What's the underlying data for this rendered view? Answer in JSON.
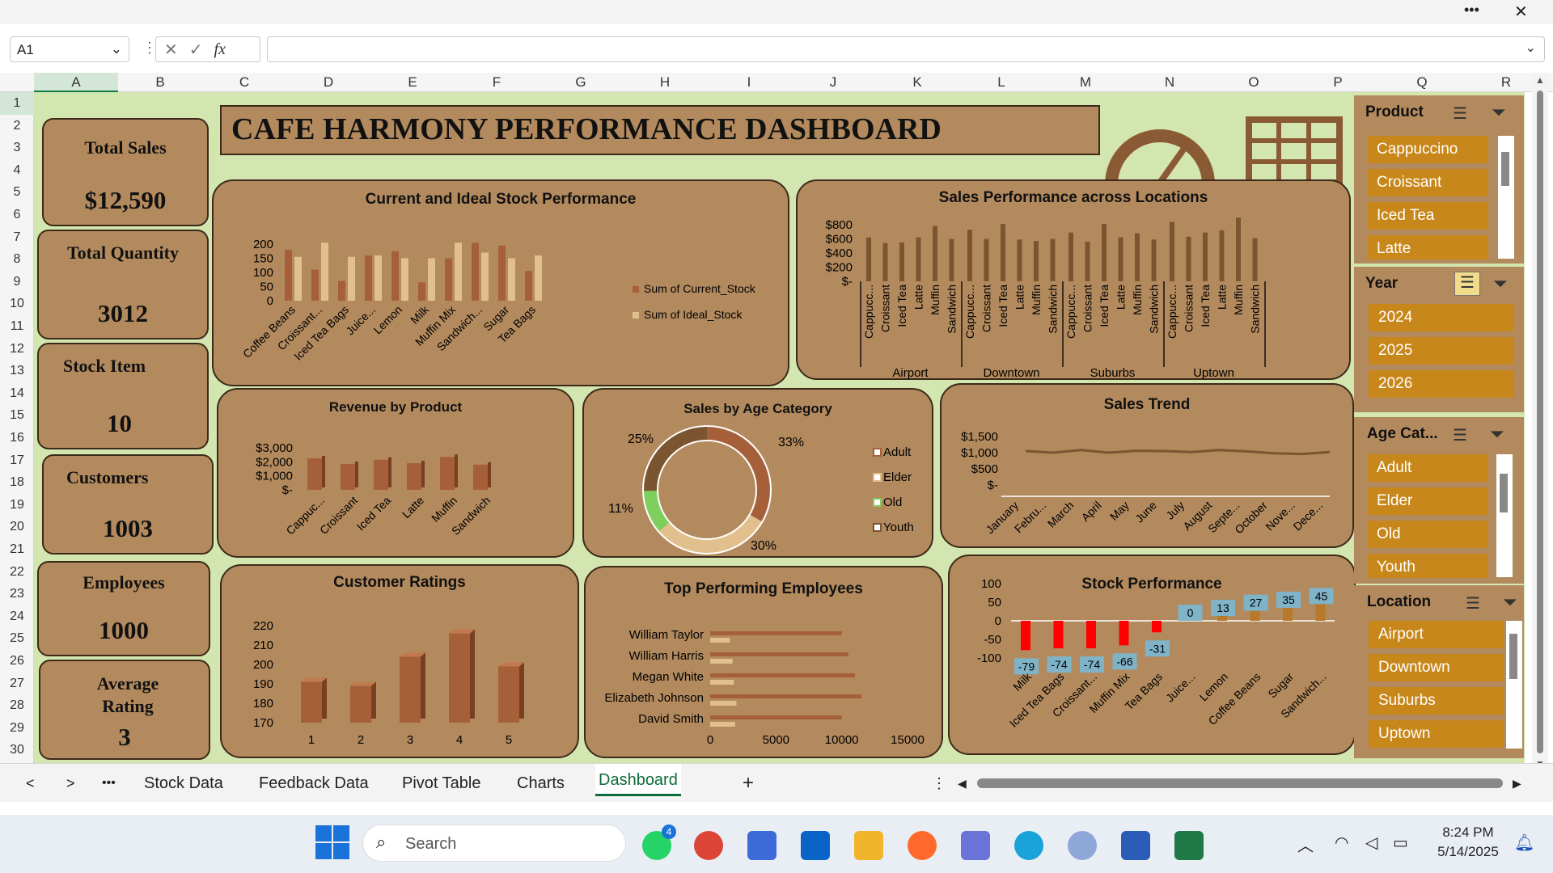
{
  "window": {
    "more_label": "•••",
    "close_label": "✕"
  },
  "formula": {
    "cell_ref": "A1",
    "fx_label": "fx",
    "value": ""
  },
  "columns": [
    "A",
    "B",
    "C",
    "D",
    "E",
    "F",
    "G",
    "H",
    "I",
    "J",
    "K",
    "L",
    "M",
    "N",
    "O",
    "P",
    "Q",
    "R"
  ],
  "rows": [
    "1",
    "2",
    "3",
    "4",
    "5",
    "6",
    "7",
    "8",
    "9",
    "10",
    "11",
    "12",
    "13",
    "14",
    "15",
    "16",
    "17",
    "18",
    "19",
    "20",
    "21",
    "22",
    "23",
    "24",
    "25",
    "26",
    "27",
    "28",
    "29",
    "30"
  ],
  "dashboard": {
    "title": "CAFE HARMONY PERFORMANCE DASHBOARD",
    "kpis": [
      {
        "label": "Total Sales",
        "value": "$12,590"
      },
      {
        "label": "Total Quantity",
        "value": "3012"
      },
      {
        "label": "Stock Item",
        "value": "10"
      },
      {
        "label": "Customers",
        "value": "1003"
      },
      {
        "label": "Employees",
        "value": "1000"
      },
      {
        "label": "Average Rating",
        "value": "3"
      }
    ]
  },
  "charts": {
    "stock": {
      "title": "Current and Ideal Stock Performance",
      "legend_current": "Sum of Current_Stock",
      "legend_ideal": "Sum of Ideal_Stock"
    },
    "locations": {
      "title": "Sales Performance across Locations"
    },
    "revenue": {
      "title": "Revenue by Product"
    },
    "age": {
      "title": "Sales by Age Category"
    },
    "trend": {
      "title": "Sales Trend"
    },
    "ratings": {
      "title": "Customer Ratings"
    },
    "employees": {
      "title": "Top Performing Employees"
    },
    "stockperf": {
      "title": "Stock Performance"
    }
  },
  "chart_data": [
    {
      "type": "bar",
      "title": "Current and Ideal Stock Performance",
      "categories": [
        "Coffee Beans",
        "Croissant...",
        "Iced Tea Bags",
        "Juice...",
        "Lemon",
        "Milk",
        "Muffin Mix",
        "Sandwich...",
        "Sugar",
        "Tea Bags"
      ],
      "yticks": [
        "0",
        "50",
        "100",
        "150",
        "200"
      ],
      "ylim": [
        0,
        200
      ],
      "series": [
        {
          "name": "Sum of Current_Stock",
          "values": [
            180,
            110,
            70,
            160,
            175,
            65,
            150,
            205,
            195,
            105
          ]
        },
        {
          "name": "Sum of Ideal_Stock",
          "values": [
            155,
            205,
            155,
            160,
            150,
            150,
            205,
            170,
            150,
            160
          ]
        }
      ],
      "legend": "right"
    },
    {
      "type": "bar",
      "title": "Sales Performance across Locations",
      "groups": [
        "Airport",
        "Downtown",
        "Suburbs",
        "Uptown"
      ],
      "categories": [
        "Cappucc...",
        "Croissant",
        "Iced Tea",
        "Latte",
        "Muffin",
        "Sandwich"
      ],
      "yticks": [
        "$-",
        "$200",
        "$400",
        "$600",
        "$800"
      ],
      "ylim": [
        0,
        800
      ],
      "values": [
        [
          620,
          540,
          550,
          620,
          780,
          600
        ],
        [
          730,
          600,
          810,
          590,
          570,
          600
        ],
        [
          690,
          560,
          810,
          620,
          680,
          590
        ],
        [
          840,
          630,
          690,
          720,
          900,
          610
        ]
      ]
    },
    {
      "type": "bar",
      "title": "Revenue by Product",
      "categories": [
        "Cappuc...",
        "Croissant",
        "Iced Tea",
        "Latte",
        "Muffin",
        "Sandwich"
      ],
      "yticks": [
        "$-",
        "$1,000",
        "$2,000",
        "$3,000"
      ],
      "ylim": [
        0,
        3000
      ],
      "values": [
        2250,
        1850,
        2150,
        1900,
        2350,
        1800
      ]
    },
    {
      "type": "pie",
      "title": "Sales by Age Category",
      "labels": [
        "Adult",
        "Elder",
        "Old",
        "Youth"
      ],
      "values": [
        33,
        30,
        11,
        25
      ],
      "display": [
        "33%",
        "30%",
        "11%",
        "25%"
      ],
      "legend": "right"
    },
    {
      "type": "line",
      "title": "Sales Trend",
      "categories": [
        "January",
        "Febru...",
        "March",
        "April",
        "May",
        "June",
        "July",
        "August",
        "Septe...",
        "October",
        "Nove...",
        "Dece..."
      ],
      "yticks": [
        "$-",
        "$500",
        "$1,000",
        "$1,500"
      ],
      "ylim": [
        0,
        1500
      ],
      "values": [
        1050,
        1000,
        1080,
        1000,
        1060,
        1050,
        1020,
        1080,
        1040,
        980,
        960,
        1020
      ]
    },
    {
      "type": "bar",
      "title": "Customer Ratings",
      "categories": [
        "1",
        "2",
        "3",
        "4",
        "5"
      ],
      "yticks": [
        "170",
        "180",
        "190",
        "200",
        "210",
        "220"
      ],
      "ylim": [
        170,
        220
      ],
      "values": [
        191,
        189,
        204,
        216,
        199
      ]
    },
    {
      "type": "bar",
      "orientation": "horizontal",
      "title": "Top Performing Employees",
      "categories": [
        "William Taylor",
        "William Harris",
        "Megan White",
        "Elizabeth Johnson",
        "David Smith"
      ],
      "xticks": [
        "0",
        "5000",
        "10000",
        "15000"
      ],
      "xlim": [
        0,
        15000
      ],
      "series": [
        {
          "values": [
            10000,
            10500,
            11000,
            11500,
            10000
          ]
        },
        {
          "values": [
            1500,
            1700,
            1800,
            2000,
            1900
          ]
        }
      ]
    },
    {
      "type": "bar",
      "title": "Stock Performance",
      "categories": [
        "Milk",
        "Iced Tea Bags",
        "Croissant...",
        "Muffin Mix",
        "Tea Bags",
        "Juice...",
        "Lemon",
        "Coffee Beans",
        "Sugar",
        "Sandwich..."
      ],
      "yticks": [
        "-100",
        "-50",
        "0",
        "50",
        "100"
      ],
      "ylim": [
        -100,
        100
      ],
      "values": [
        -79,
        -74,
        -74,
        -66,
        -31,
        0,
        13,
        27,
        35,
        45
      ],
      "labels": [
        "-79",
        "-74",
        "-74",
        "-66",
        "-31",
        "0",
        "13",
        "27",
        "35",
        "45"
      ]
    }
  ],
  "slicers": {
    "product": {
      "header": "Product",
      "items": [
        "Cappuccino",
        "Croissant",
        "Iced Tea",
        "Latte"
      ]
    },
    "year": {
      "header": "Year",
      "items": [
        "2024",
        "2025",
        "2026"
      ]
    },
    "age": {
      "header": "Age Cat...",
      "items": [
        "Adult",
        "Elder",
        "Old",
        "Youth"
      ]
    },
    "location": {
      "header": "Location",
      "items": [
        "Airport",
        "Downtown",
        "Suburbs",
        "Uptown"
      ]
    }
  },
  "tabs": {
    "items": [
      "Stock Data",
      "Feedback Data",
      "Pivot Table",
      "Charts",
      "Dashboard"
    ],
    "active": "Dashboard",
    "add": "+",
    "more": "•••"
  },
  "taskbar": {
    "search_placeholder": "Search",
    "time": "8:24 PM",
    "date": "5/14/2025",
    "whatsapp_badge": "4"
  },
  "colors": {
    "panel": "#b38a5e",
    "border": "#3b2a1a",
    "sheet": "#d4e6b0",
    "slicer_item": "#c8871a",
    "bar_dark": "#a5603a",
    "bar_light": "#e2c08e",
    "negative": "#ff0000"
  }
}
